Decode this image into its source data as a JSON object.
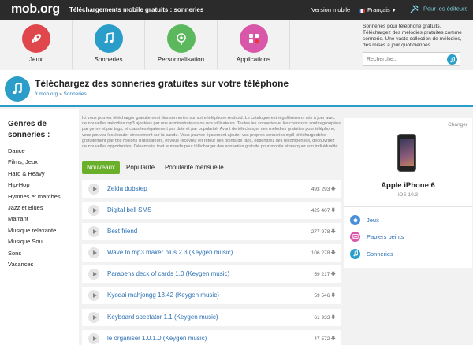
{
  "topbar": {
    "logo": "mob.org",
    "title": "Téléchargements mobile gratuits : sonneries",
    "version": "Version mobile",
    "language": "Français",
    "editors": "Pour les éditeurs"
  },
  "categories": [
    {
      "label": "Jeux",
      "color": "#e0474c",
      "icon": "rocket-icon"
    },
    {
      "label": "Sonneries",
      "color": "#2a9ec9",
      "icon": "music-note-icon"
    },
    {
      "label": "Personnalisation",
      "color": "#5cb85c",
      "icon": "flower-icon"
    },
    {
      "label": "Applications",
      "color": "#d957a8",
      "icon": "apps-grid-icon"
    }
  ],
  "side_info": "Sonneries pour téléphone gratuits. Téléchargez des mélodies gratuites comme sonnerie. Une vaste collection de mélodies, des mises à jour quotidiennes.",
  "search": {
    "placeholder": "Recherche..."
  },
  "header": {
    "title": "Téléchargez des sonneries gratuites sur votre téléphone",
    "crumb_home": "fr.mob.org",
    "crumb_sep": " » ",
    "crumb_current": "Sonneries"
  },
  "sidebar": {
    "title": "Genres de sonneries :",
    "items": [
      "Dance",
      "Films, Jeux",
      "Hard & Heavy",
      "Hip-Hop",
      "Hymnes et marches",
      "Jazz et Blues",
      "Marrant",
      "Musique relaxante",
      "Musique Soul",
      "Sons",
      "Vacances"
    ]
  },
  "description": "Ici vous pouvez télécharger gratuitement des sonneries sur votre téléphone Android. Le catalogue est régulièrement mis à jour avec de nouvelles mélodies mp3 ajoutées par nos administrateurs ou nos utilisateurs. Toutes les sonneries et les chansons sont regroupées par genre et par tags, et classées également par date et par popularité. Avant de télécharger des mélodies gratuites pour téléphone, vous pouvez les écouter directement sur la bande. Vous pouvez également ajouter vos propres sonneries mp3 téléchargeables gratuitement par nos millions d'utilisateurs, et vous recevrez en retour des points de fans, obtiendrez des récompenses, découvrirez de nouvelles opportunités. Désormais, tout le monde peut télécharger des sonneries gratuite pour mobile et marquer son individualité.",
  "tabs": [
    "Nouveaux",
    "Popularité",
    "Popularité mensuelle"
  ],
  "ringtones": [
    {
      "name": "Zelda dubstep",
      "downloads": "493 293"
    },
    {
      "name": "Digital bell SMS",
      "downloads": "425 407"
    },
    {
      "name": "Best friend",
      "downloads": "277 978"
    },
    {
      "name": "Wave to mp3 maker plus 2.3 (Keygen music)",
      "downloads": "106 278"
    },
    {
      "name": "Parabens deck of cards 1.0 (Keygen music)",
      "downloads": "59 217"
    },
    {
      "name": "Kyodai mahjongg 18.42 (Keygen music)",
      "downloads": "59 546"
    },
    {
      "name": "Keyboard spectator 1.1 (Keygen music)",
      "downloads": "61 933"
    },
    {
      "name": "le organiser 1.0.1.0 (Keygen music)",
      "downloads": "47 572"
    }
  ],
  "device": {
    "change": "Changer",
    "model": "Apple iPhone 6",
    "os": "iOS 10.3"
  },
  "device_links": [
    {
      "label": "Jeux",
      "icon": "apple-icon",
      "color": "#4a90d9"
    },
    {
      "label": "Papiers peints",
      "icon": "wallpaper-icon",
      "color": "#d957a8"
    },
    {
      "label": "Sonneries",
      "icon": "music-note-icon",
      "color": "#2a9ec9"
    }
  ]
}
